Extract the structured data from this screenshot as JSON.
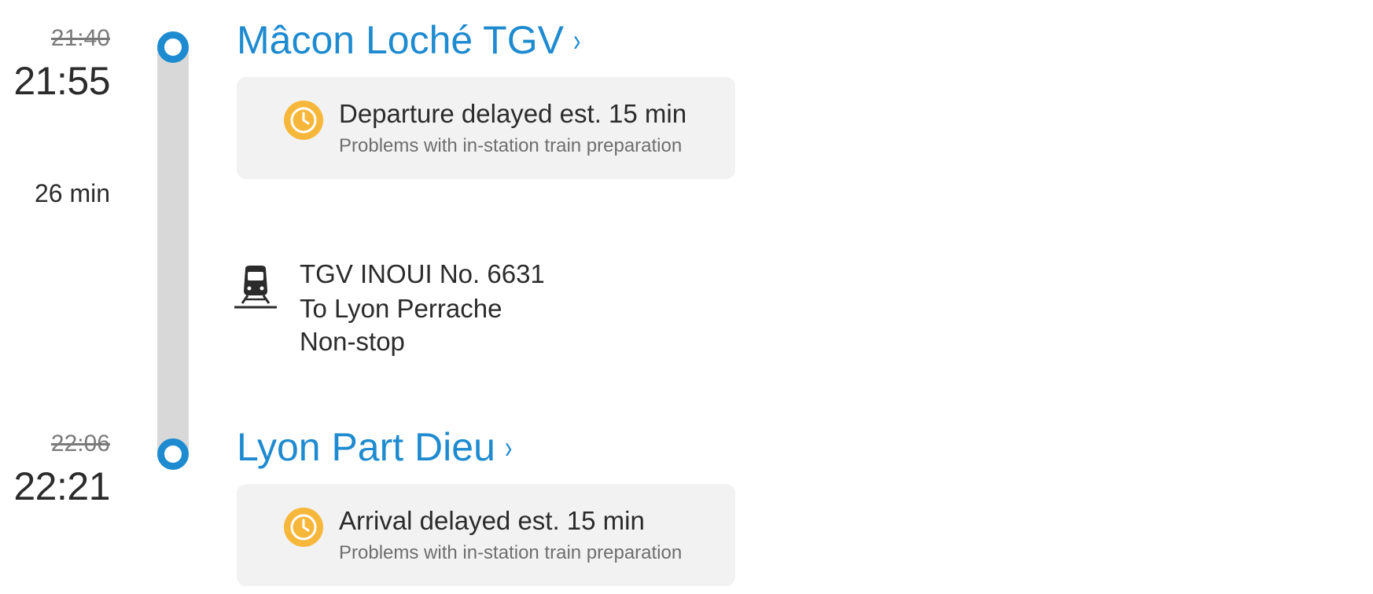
{
  "departure": {
    "scheduled_time": "21:40",
    "estimated_time": "21:55",
    "station": "Mâcon Loché TGV",
    "chevron": "›",
    "delay_title": "Departure delayed est. 15 min",
    "delay_reason": "Problems with in-station train preparation"
  },
  "leg": {
    "duration": "26 min",
    "train_name": "TGV INOUI No. 6631",
    "direction": "To Lyon Perrache",
    "stops": "Non-stop",
    "icon": "train-icon"
  },
  "arrival": {
    "scheduled_time": "22:06",
    "estimated_time": "22:21",
    "station": "Lyon Part Dieu",
    "chevron": "›",
    "delay_title": "Arrival delayed est. 15 min",
    "delay_reason": "Problems with in-station train preparation"
  },
  "colors": {
    "accent": "#1e8bd0",
    "warning": "#f7b73b",
    "track": "#d8d8d8",
    "card_bg": "#f2f2f2"
  }
}
